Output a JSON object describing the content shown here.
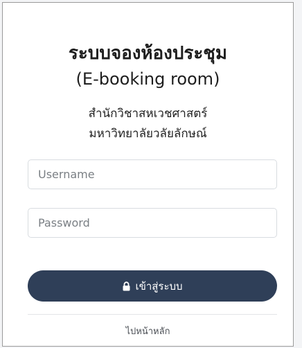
{
  "header": {
    "title": "ระบบจองห้องประชุม",
    "subtitle": "(E-booking room)",
    "department_line1": "สำนักวิชาสหเวชศาสตร์",
    "department_line2": "มหาวิทยาลัยวลัยลักษณ์"
  },
  "form": {
    "username_placeholder": "Username",
    "username_value": "",
    "password_placeholder": "Password",
    "password_value": "",
    "login_label": "เข้าสู่ระบบ",
    "login_icon": "lock-icon",
    "accent_color": "#2f3f58"
  },
  "footer": {
    "home_link_label": "ไปหน้าหลัก"
  }
}
